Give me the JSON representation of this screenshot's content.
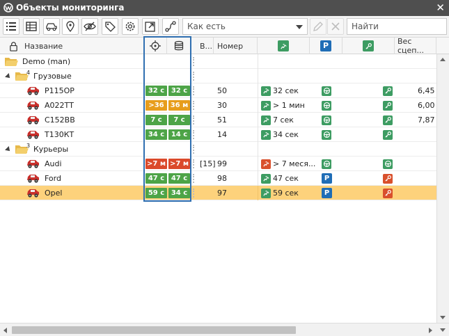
{
  "window": {
    "title": "Объекты мониторинга"
  },
  "toolbar": {
    "view_mode": "Как есть",
    "search_placeholder": "Найти"
  },
  "columns": {
    "name": "Название",
    "v": "В...",
    "number": "Номер",
    "weight": "Вес сцеп..."
  },
  "groups": {
    "root": {
      "label": "Demo (man)"
    },
    "cargo": {
      "label": "Грузовые",
      "count": "4"
    },
    "couriers": {
      "label": "Курьеры",
      "count": "3"
    }
  },
  "units": [
    {
      "name": "Р115ОР",
      "pos": "32 с",
      "pos_color": "green",
      "msg": "32 с",
      "msg_color": "green",
      "v": "",
      "number": "50",
      "motion": "32 сек",
      "motion_state": "green",
      "parking": "steering",
      "ignition": "key-green",
      "weight": "6,45"
    },
    {
      "name": "А022ТТ",
      "pos": ">36 м",
      "pos_color": "orange",
      "msg": "36 м",
      "msg_color": "orange",
      "v": "",
      "number": "30",
      "motion": "> 1 мин",
      "motion_state": "green",
      "parking": "steering",
      "ignition": "key-green",
      "weight": "6,00"
    },
    {
      "name": "С152ВВ",
      "pos": "7 с",
      "pos_color": "green",
      "msg": "7 с",
      "msg_color": "green",
      "v": "",
      "number": "51",
      "motion": "7 сек",
      "motion_state": "green",
      "parking": "steering",
      "ignition": "key-green",
      "weight": "7,87"
    },
    {
      "name": "Т130КТ",
      "pos": "34 с",
      "pos_color": "green",
      "msg": "14 с",
      "msg_color": "green",
      "v": "",
      "number": "14",
      "motion": "34 сек",
      "motion_state": "green",
      "parking": "steering",
      "ignition": "key-green",
      "weight": ""
    },
    {
      "name": "Audi",
      "pos": ">7 м",
      "pos_color": "red",
      "msg": ">7 м",
      "msg_color": "red",
      "v": "[15]",
      "number": "99",
      "motion": "> 7 меся...",
      "motion_state": "red",
      "parking": "steering",
      "ignition": "steering",
      "weight": ""
    },
    {
      "name": "Ford",
      "pos": "47 с",
      "pos_color": "green",
      "msg": "47 с",
      "msg_color": "green",
      "v": "",
      "number": "98",
      "motion": "47 сек",
      "motion_state": "green",
      "parking": "P",
      "ignition": "key-red",
      "weight": ""
    },
    {
      "name": "Opel",
      "pos": "59 с",
      "pos_color": "green",
      "msg": "34 с",
      "msg_color": "green",
      "v": "",
      "number": "97",
      "motion": "59 сек",
      "motion_state": "green",
      "parking": "P",
      "ignition": "key-red",
      "weight": ""
    }
  ],
  "colors": {
    "accent_blue": "#2f6fb1",
    "status_green": "#4da447",
    "status_orange": "#e79d1c",
    "status_red": "#db4a2b",
    "selected_row": "#fdd27c"
  }
}
